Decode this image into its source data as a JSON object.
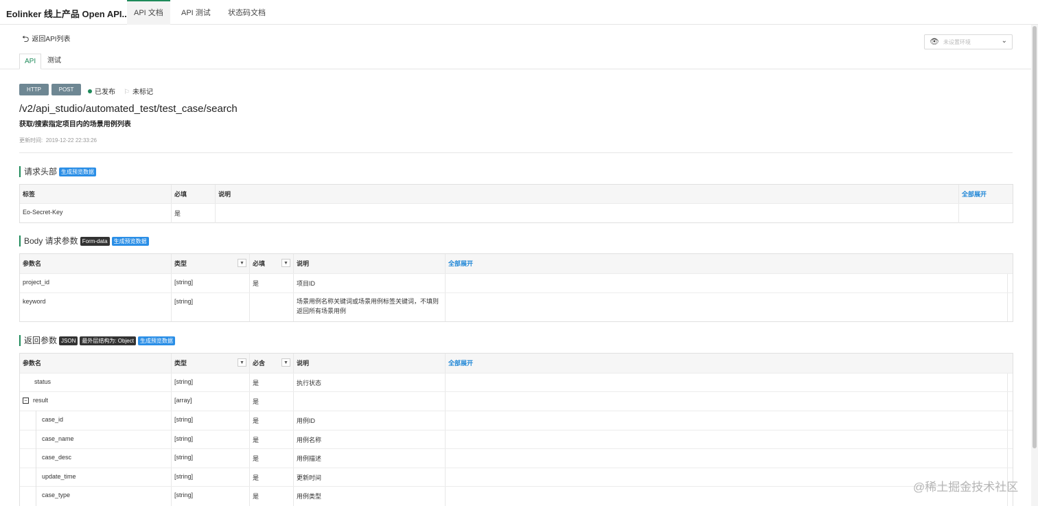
{
  "app": {
    "title": "Eolinker 线上产品 Open API..."
  },
  "nav": {
    "tabs": [
      "API 文档",
      "API 测试",
      "状态码文档"
    ]
  },
  "subbar": {
    "back_label": "返回API列表",
    "env_placeholder": "未设置环境",
    "tabs": [
      "API",
      "测试"
    ]
  },
  "api": {
    "protocol": "HTTP",
    "method": "POST",
    "status": "已发布",
    "mark": "未标记",
    "path": "/v2/api_studio/automated_test/test_case/search",
    "description": "获取/搜索指定项目内的场景用例列表",
    "update_label": "更新时间:",
    "update_time": "2019-12-22 22:33:26"
  },
  "headers_section": {
    "title": "请求头部",
    "badge": "生成预览数据",
    "columns": [
      "标签",
      "必填",
      "说明"
    ],
    "expand_all": "全部展开",
    "rows": [
      {
        "name": "Eo-Secret-Key",
        "required": "是",
        "desc": ""
      }
    ]
  },
  "body_section": {
    "title": "Body 请求参数",
    "badge_type": "Form-data",
    "badge": "生成预览数据",
    "columns": [
      "参数名",
      "类型",
      "必填",
      "说明"
    ],
    "expand_all": "全部展开",
    "rows": [
      {
        "name": "project_id",
        "type": "[string]",
        "required": "是",
        "desc": "项目ID"
      },
      {
        "name": "keyword",
        "type": "[string]",
        "required": "",
        "desc": "场景用例名称关键词或场景用例标签关键词，不填则返回所有场景用例"
      }
    ]
  },
  "return_section": {
    "title": "返回参数",
    "badge_type": "JSON",
    "badge_struct": "最外层结构为: Object",
    "badge": "生成预览数据",
    "columns": [
      "参数名",
      "类型",
      "必含",
      "说明"
    ],
    "expand_all": "全部展开",
    "rows": [
      {
        "name": "status",
        "type": "[string]",
        "required": "是",
        "desc": "执行状态"
      },
      {
        "name": "result",
        "type": "[array]",
        "required": "是",
        "desc": ""
      },
      {
        "name": "case_id",
        "type": "[string]",
        "required": "是",
        "desc": "用例ID"
      },
      {
        "name": "case_name",
        "type": "[string]",
        "required": "是",
        "desc": "用例名称"
      },
      {
        "name": "case_desc",
        "type": "[string]",
        "required": "是",
        "desc": "用例描述"
      },
      {
        "name": "update_time",
        "type": "[string]",
        "required": "是",
        "desc": "更新时间"
      },
      {
        "name": "case_type",
        "type": "[string]",
        "required": "是",
        "desc": "用例类型"
      }
    ]
  },
  "icons": {
    "back": "undo-arrow-icon",
    "eye": "eye-icon",
    "chevron": "chevron-down-icon",
    "flag": "flag-icon",
    "filter": "filter-dropdown-icon",
    "collapse": "minus-square-icon"
  },
  "colors": {
    "accent": "#1e8a5a",
    "badge_blue": "#2a8ee6",
    "tag_gray": "#6e8793",
    "link": "#1f86d6"
  },
  "watermark": "@稀土掘金技术社区"
}
